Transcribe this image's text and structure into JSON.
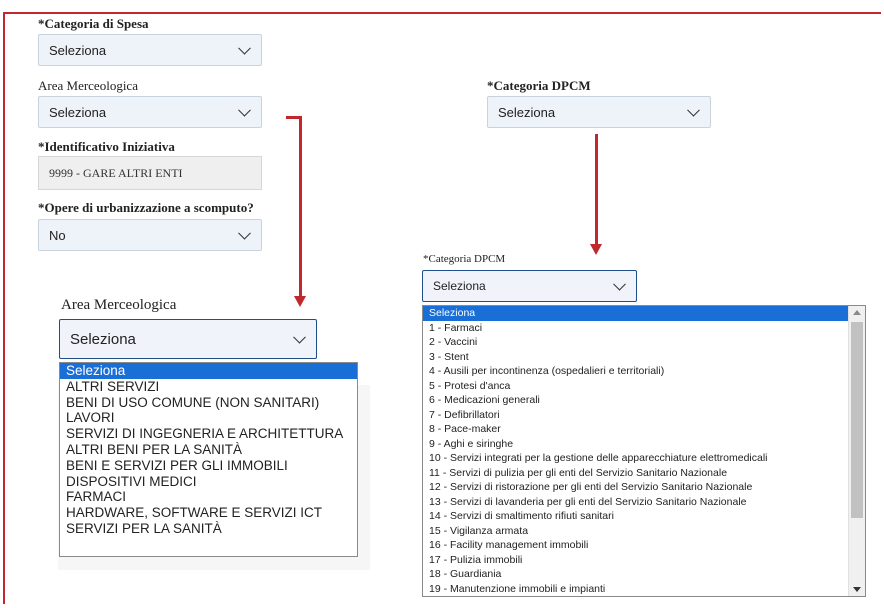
{
  "form": {
    "categoria_spesa": {
      "label": "*Categoria di Spesa",
      "value": "Seleziona"
    },
    "area_merceologica": {
      "label": "Area Merceologica",
      "value": "Seleziona"
    },
    "categoria_dpcm": {
      "label": "*Categoria DPCM",
      "value": "Seleziona"
    },
    "identificativo": {
      "label": "*Identificativo Iniziativa",
      "value": "9999 - GARE ALTRI ENTI"
    },
    "opere": {
      "label": "*Opere di urbanizzazione a scomputo?",
      "value": "No"
    }
  },
  "zoom_area": {
    "label": "Area Merceologica",
    "value": "Seleziona",
    "options": [
      "Seleziona",
      "ALTRI SERVIZI",
      "BENI DI USO COMUNE (NON SANITARI)",
      "LAVORI",
      "SERVIZI DI INGEGNERIA E ARCHITETTURA",
      "ALTRI BENI PER LA SANITÀ",
      "BENI E SERVIZI PER GLI IMMOBILI",
      "DISPOSITIVI MEDICI",
      "FARMACI",
      "HARDWARE, SOFTWARE E SERVIZI ICT",
      "SERVIZI PER LA SANITÀ"
    ]
  },
  "zoom_dpcm": {
    "label": "*Categoria DPCM",
    "value": "Seleziona",
    "options": [
      "Seleziona",
      "1 - Farmaci",
      "2 - Vaccini",
      "3 - Stent",
      "4 - Ausili per incontinenza (ospedalieri e territoriali)",
      "5 - Protesi d'anca",
      "6 - Medicazioni generali",
      "7 - Defibrillatori",
      "8 - Pace-maker",
      "9 - Aghi e siringhe",
      "10 - Servizi integrati per la gestione delle apparecchiature elettromedicali",
      "11 - Servizi di pulizia per gli enti del Servizio Sanitario Nazionale",
      "12 - Servizi di ristorazione per gli enti del Servizio Sanitario Nazionale",
      "13 - Servizi di lavanderia per gli enti del Servizio Sanitario Nazionale",
      "14 - Servizi di smaltimento rifiuti sanitari",
      "15 - Vigilanza armata",
      "16 - Facility management immobili",
      "17 - Pulizia immobili",
      "18 - Guardiania",
      "19 - Manutenzione immobili e impianti"
    ]
  },
  "colors": {
    "annotation_red": "#c0282d",
    "highlight_blue": "#1a6fd6",
    "field_bg": "#eef3f9"
  },
  "icons": {
    "dropdown": "chevron-down-icon",
    "annotation": "red-arrow"
  }
}
